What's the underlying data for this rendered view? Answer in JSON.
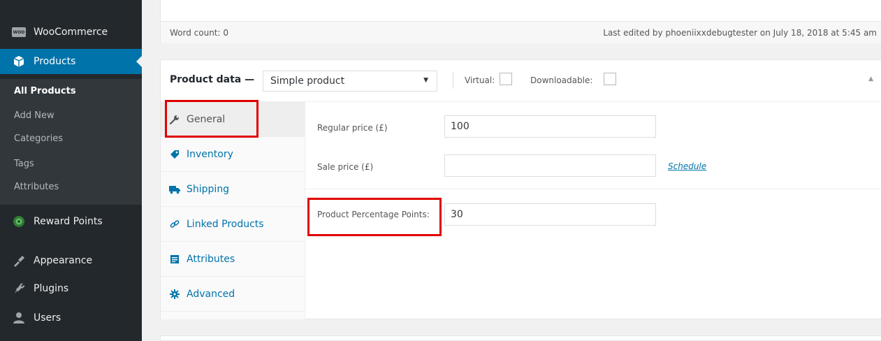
{
  "sidebar": {
    "woocommerce": {
      "label": "WooCommerce",
      "icon": "woo-icon",
      "badge": "WOO"
    },
    "products": {
      "label": "Products",
      "icon": "products-icon"
    },
    "submenu": [
      "All Products",
      "Add New",
      "Categories",
      "Tags",
      "Attributes"
    ],
    "reward_points": {
      "label": "Reward Points",
      "icon": "reward-points-icon"
    },
    "appearance": {
      "label": "Appearance",
      "icon": "appearance-icon"
    },
    "plugins": {
      "label": "Plugins",
      "icon": "plugins-icon"
    },
    "users": {
      "label": "Users",
      "icon": "users-icon"
    }
  },
  "editor_status": {
    "word_count": "Word count: 0",
    "last_edited": "Last edited by phoeniixxdebugtester on July 18, 2018 at 5:45 am"
  },
  "product_data": {
    "title": "Product data —",
    "product_type": "Simple product",
    "virtual_label": "Virtual:",
    "downloadable_label": "Downloadable:",
    "virtual_checked": false,
    "downloadable_checked": false,
    "tabs": [
      {
        "label": "General",
        "icon": "wrench-icon",
        "active": true
      },
      {
        "label": "Inventory",
        "icon": "tag-icon"
      },
      {
        "label": "Shipping",
        "icon": "truck-icon"
      },
      {
        "label": "Linked Products",
        "icon": "link-icon"
      },
      {
        "label": "Attributes",
        "icon": "list-icon"
      },
      {
        "label": "Advanced",
        "icon": "gear-icon"
      }
    ],
    "fields": {
      "regular_price": {
        "label": "Regular price (£)",
        "value": "100"
      },
      "sale_price": {
        "label": "Sale price (£)",
        "value": ""
      },
      "schedule_link": "Schedule",
      "percentage_points": {
        "label": "Product Percentage Points:",
        "value": "30"
      }
    }
  },
  "colors": {
    "sidebar_bg": "#23282d",
    "submenu_bg": "#32373c",
    "active_blue": "#0073aa",
    "highlight_red": "#e00000"
  }
}
